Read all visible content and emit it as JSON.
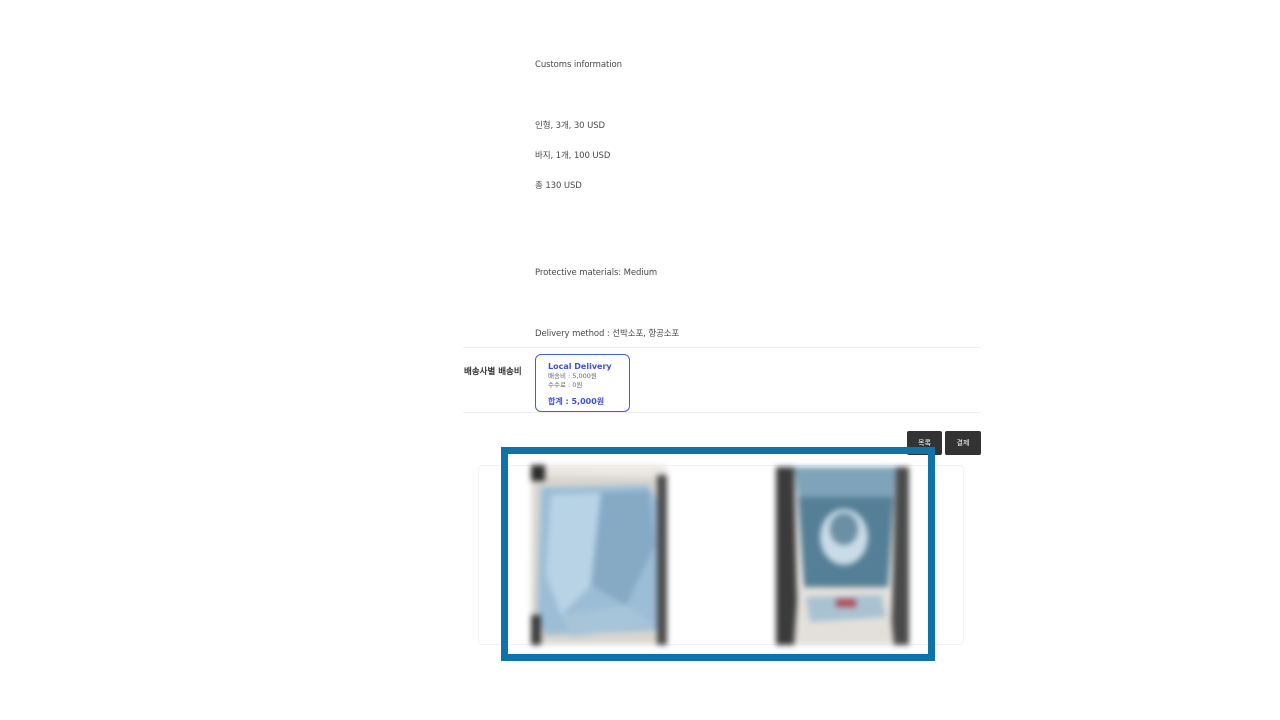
{
  "customs": {
    "heading": "Customs information",
    "items": [
      "인형, 3개, 30 USD",
      "바지, 1개, 100 USD",
      "총 130 USD"
    ],
    "protective": "Protective materials: Medium",
    "delivery_method": "Delivery method : 선박소포, 항공소포"
  },
  "shipping_fee": {
    "row_label": "배송사별 배송비",
    "card": {
      "title": "Local Delivery",
      "fee": "배송비 : 5,000원",
      "commission": "수수료 : 0원",
      "total": "합계 : 5,000원",
      "accent_color": "#3f51d8"
    }
  },
  "actions": {
    "list_label": "목록",
    "pay_label": "결제"
  },
  "gallery": {
    "photos": [
      {
        "label": "package-photo-1",
        "dominant_color": "#8fb3cf"
      },
      {
        "label": "package-photo-2",
        "dominant_color": "#6f97ad"
      }
    ]
  },
  "highlight": {
    "color": "#0e73a8"
  }
}
